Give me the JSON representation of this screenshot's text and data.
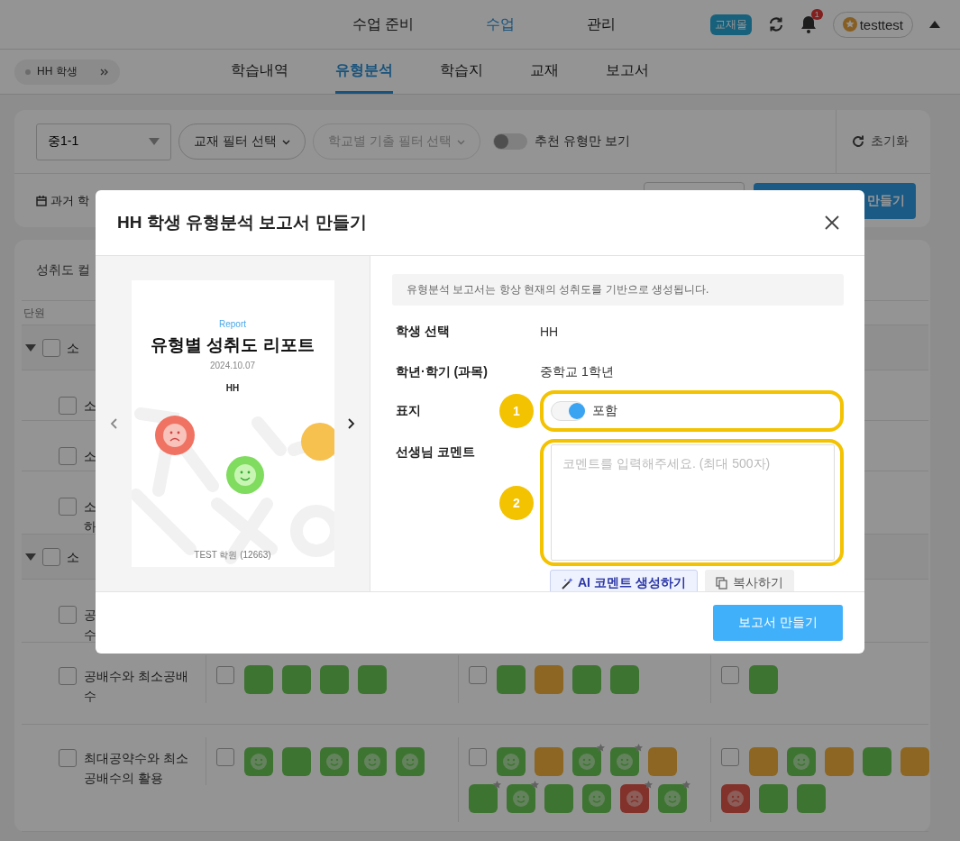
{
  "top_nav": {
    "items": [
      {
        "label": "수업 준비",
        "selected": false
      },
      {
        "label": "수업",
        "selected": true
      },
      {
        "label": "관리",
        "selected": false
      }
    ],
    "badge": "교재몰",
    "notification_count": "1",
    "user": "testtest"
  },
  "student_chip": {
    "label": "HH 학생"
  },
  "sub_tabs": [
    {
      "label": "학습내역",
      "selected": false
    },
    {
      "label": "유형분석",
      "selected": true
    },
    {
      "label": "학습지",
      "selected": false
    },
    {
      "label": "교재",
      "selected": false
    },
    {
      "label": "보고서",
      "selected": false
    }
  ],
  "filters": {
    "grade_select": "중1-1",
    "textbook_filter": "교재 필터 선택",
    "school_filter": "학교별 기출 필터 선택",
    "recommend_toggle": {
      "label": "추천 유형만 보기",
      "on": false
    },
    "reset": "초기화",
    "past_label": "과거 학",
    "make_button": "만들기"
  },
  "table": {
    "legend_label": "성취도 컬",
    "unit_header": "단원",
    "rows": [
      {
        "kind": "group",
        "lines": [
          "소"
        ],
        "expanded": true,
        "checked": false
      },
      {
        "kind": "unit",
        "lines": [
          "소"
        ],
        "checked": false
      },
      {
        "kind": "unit",
        "lines": [
          "소"
        ],
        "checked": false
      },
      {
        "kind": "unit",
        "lines": [
          "소",
          "하"
        ],
        "checked": false
      },
      {
        "kind": "group",
        "lines": [
          "소"
        ],
        "expanded": true,
        "checked": false
      },
      {
        "kind": "unit",
        "lines": [
          "공",
          "수"
        ],
        "checked": false
      },
      {
        "kind": "unit",
        "lines": [
          "공배수와 최소공배",
          "수"
        ],
        "checked": false,
        "cells": [
          {
            "checked": false,
            "tiles": [
              {
                "kind": "good",
                "face": false,
                "starred": false
              },
              {
                "kind": "good",
                "face": false,
                "starred": false
              },
              {
                "kind": "good",
                "face": false,
                "starred": false
              },
              {
                "kind": "good",
                "face": false,
                "starred": false
              }
            ]
          },
          {
            "checked": false,
            "tiles": [
              {
                "kind": "good",
                "face": false,
                "starred": false
              },
              {
                "kind": "mid",
                "face": false,
                "starred": false
              },
              {
                "kind": "good",
                "face": false,
                "starred": false
              },
              {
                "kind": "good",
                "face": false,
                "starred": false
              }
            ]
          },
          {
            "checked": false,
            "tiles": [
              {
                "kind": "good",
                "face": false,
                "starred": false
              }
            ]
          }
        ]
      },
      {
        "kind": "unit",
        "lines": [
          "최대공약수와 최소",
          "공배수의 활용"
        ],
        "checked": false,
        "cells": [
          {
            "checked": false,
            "tiles": [
              {
                "kind": "good",
                "face": true,
                "starred": false
              },
              {
                "kind": "good",
                "face": false,
                "starred": false
              },
              {
                "kind": "good",
                "face": true,
                "starred": false
              },
              {
                "kind": "good",
                "face": true,
                "starred": false
              },
              {
                "kind": "good",
                "face": true,
                "starred": false
              }
            ]
          },
          {
            "checked": false,
            "tiles": [
              {
                "kind": "good",
                "face": true,
                "starred": false
              },
              {
                "kind": "mid",
                "face": false,
                "starred": false
              },
              {
                "kind": "good",
                "face": true,
                "starred": true
              },
              {
                "kind": "good",
                "face": true,
                "starred": true
              },
              {
                "kind": "mid",
                "face": false,
                "starred": false
              },
              {
                "kind": "good",
                "face": false,
                "starred": true
              },
              {
                "kind": "good",
                "face": true,
                "starred": true
              },
              {
                "kind": "good",
                "face": false,
                "starred": false
              },
              {
                "kind": "good",
                "face": true,
                "starred": false
              },
              {
                "kind": "bad",
                "face": true,
                "starred": true
              },
              {
                "kind": "good",
                "face": true,
                "starred": true
              }
            ]
          },
          {
            "checked": false,
            "tiles": [
              {
                "kind": "mid",
                "face": false,
                "starred": false
              },
              {
                "kind": "good",
                "face": true,
                "starred": false
              },
              {
                "kind": "mid",
                "face": false,
                "starred": false
              },
              {
                "kind": "good",
                "face": false,
                "starred": false
              },
              {
                "kind": "mid",
                "face": false,
                "starred": false
              },
              {
                "kind": "bad",
                "face": true,
                "starred": false
              },
              {
                "kind": "good",
                "face": false,
                "starred": false
              },
              {
                "kind": "good",
                "face": false,
                "starred": false
              }
            ]
          }
        ]
      }
    ]
  },
  "modal": {
    "title": "HH 학생 유형분석 보고서 만들기",
    "preview": {
      "report_label": "Report",
      "title": "유형별 성취도 리포트",
      "date": "2024.10.07",
      "student": "HH",
      "footer": "TEST 학원 (12663)"
    },
    "notice": "유형분석 보고서는 항상 현재의 성취도를 기반으로 생성됩니다.",
    "fields": [
      {
        "kind": "text",
        "label": "학생 선택",
        "value": "HH"
      },
      {
        "kind": "text",
        "label": "학년·학기 (과목)",
        "value": "중학교 1학년"
      },
      {
        "kind": "toggle",
        "label": "표지",
        "marker": "1",
        "on": true,
        "value": "포함"
      },
      {
        "kind": "comment",
        "label": "선생님 코멘트",
        "marker": "2",
        "placeholder": "코멘트를 입력해주세요. (최대 500자)",
        "actions": [
          "AI 코멘트 생성하기",
          "복사하기"
        ]
      }
    ],
    "submit": "보고서 만들기"
  }
}
